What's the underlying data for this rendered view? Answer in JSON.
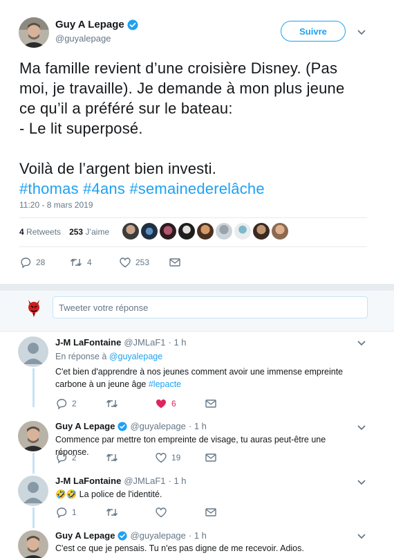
{
  "tweet": {
    "author_name": "Guy A Lepage",
    "author_handle": "@guyalepage",
    "follow_label": "Suivre",
    "text": "Ma famille revient d’une croisière Disney. (Pas moi, je travaille). Je demande à mon plus jeune ce qu’il a préféré sur le bateau:\n- Le lit superposé.\n\nVoilà de l’argent bien investi.",
    "hashtags": "#thomas #4ans #semainederelâche",
    "timestamp": "11:20 - 8 mars 2019",
    "retweets_count": "4",
    "retweets_label": "Retweets",
    "likes_count": "253",
    "likes_label": "J’aime",
    "actions": {
      "replies": "28",
      "retweets": "4",
      "likes": "253"
    }
  },
  "reply_box": {
    "placeholder": "Tweeter votre réponse"
  },
  "replies": [
    {
      "name": "J-M LaFontaine",
      "handle": "@JMLaF1",
      "time": "· 1 h",
      "context_prefix": "En réponse à",
      "context_handle": "@guyalepage",
      "text": "C'et bien d'apprendre à nos jeunes comment avoir une immense empreinte carbone à un jeune âge",
      "hashtag": "#lepacte",
      "replies": "2",
      "retweets": "",
      "likes": "6"
    },
    {
      "name": "Guy A Lepage",
      "handle": "@guyalepage",
      "time": "· 1 h",
      "text": "Commence par mettre ton empreinte de visage, tu auras peut-être une réponse.",
      "replies": "2",
      "retweets": "",
      "likes": "19"
    },
    {
      "name": "J-M LaFontaine",
      "handle": "@JMLaF1",
      "time": "· 1 h",
      "emoji": "🤣🤣",
      "text": "La police de l'identité.",
      "replies": "1",
      "retweets": "",
      "likes": ""
    },
    {
      "name": "Guy A Lepage",
      "handle": "@guyalepage",
      "time": "· 1 h",
      "text": "C'est ce que je pensais. Tu n'es pas digne de me recevoir. Adios."
    }
  ],
  "colors": {
    "accent": "#1da1f2",
    "like": "#e0245e",
    "muted": "#657786",
    "border": "#e6ecf0"
  }
}
